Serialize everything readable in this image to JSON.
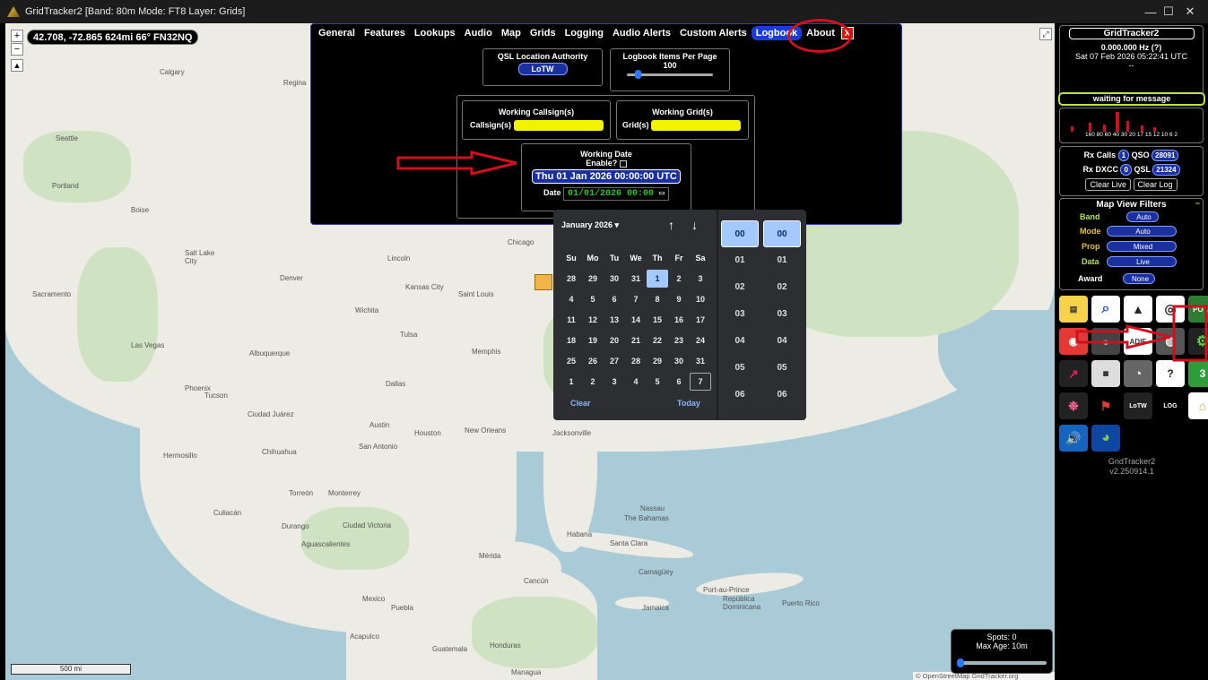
{
  "window": {
    "title": "GridTracker2 [Band: 80m Mode: FT8 Layer: Grids]",
    "minimize": "—",
    "maximize": "☐",
    "close": "✕"
  },
  "map": {
    "coords": "42.708, -72.865 624mi 66° FN32NQ",
    "zoom_in": "+",
    "zoom_out": "−",
    "scale_label": "500 mi",
    "attribution": "© OpenStreetMap GridTracker.org",
    "spots_label": "Spots: 0",
    "max_age_label": "Max Age: 10m",
    "cities": [
      {
        "n": "Calgary"
      },
      {
        "n": "Regina"
      },
      {
        "n": "Seattle"
      },
      {
        "n": "Portland"
      },
      {
        "n": "Boise"
      },
      {
        "n": "Salt Lake City"
      },
      {
        "n": "Denver"
      },
      {
        "n": "Sacramento"
      },
      {
        "n": "Las Vegas"
      },
      {
        "n": "Phoenix"
      },
      {
        "n": "Tucson"
      },
      {
        "n": "Albuquerque"
      },
      {
        "n": "Wichita"
      },
      {
        "n": "Kansas City"
      },
      {
        "n": "Lincoln"
      },
      {
        "n": "Chicago"
      },
      {
        "n": "Saint Louis"
      },
      {
        "n": "Tulsa"
      },
      {
        "n": "Memphis"
      },
      {
        "n": "Dallas"
      },
      {
        "n": "Austin"
      },
      {
        "n": "Houston"
      },
      {
        "n": "San Antonio"
      },
      {
        "n": "New Orleans"
      },
      {
        "n": "Jacksonville"
      },
      {
        "n": "Ciudad Juárez"
      },
      {
        "n": "Chihuahua"
      },
      {
        "n": "Monterrey"
      },
      {
        "n": "Culiacán"
      },
      {
        "n": "Durango"
      },
      {
        "n": "Aguascalientes"
      },
      {
        "n": "Ciudad Victoria"
      },
      {
        "n": "Mexico"
      },
      {
        "n": "Puebla"
      },
      {
        "n": "Acapulco"
      },
      {
        "n": "Mérida"
      },
      {
        "n": "Cancún"
      },
      {
        "n": "Habana"
      },
      {
        "n": "Santa Clara"
      },
      {
        "n": "Camagüey"
      },
      {
        "n": "The Bahamas"
      },
      {
        "n": "Nassau"
      },
      {
        "n": "Jamaica"
      },
      {
        "n": "Port-au-Prince"
      },
      {
        "n": "República Dominicana"
      },
      {
        "n": "Puerto Rico"
      },
      {
        "n": "Guatemala"
      },
      {
        "n": "Honduras"
      },
      {
        "n": "Managua"
      },
      {
        "n": "Torreón"
      },
      {
        "n": "Hermosillo"
      }
    ]
  },
  "settings": {
    "tabs": [
      "General",
      "Features",
      "Lookups",
      "Audio",
      "Map",
      "Grids",
      "Logging",
      "Audio Alerts",
      "Custom Alerts",
      "Logbook",
      "About"
    ],
    "active_tab": "Logbook",
    "close_label": "X",
    "qsl_authority": {
      "label": "QSL Location Authority",
      "value": "LoTW"
    },
    "items_per_page": {
      "label": "Logbook Items Per Page",
      "value": "100",
      "slider_fraction": 0.1
    },
    "working_callsign": {
      "label": "Working Callsign(s)",
      "field_label": "Callsign(s)",
      "value": ""
    },
    "working_grid": {
      "label": "Working Grid(s)",
      "field_label": "Grid(s)",
      "value": ""
    },
    "working_date": {
      "label": "Working Date",
      "enable_label": "Enable?",
      "enabled": false,
      "display": "Thu 01 Jan 2026 00:00:00 UTC",
      "date_label": "Date",
      "date_value": "01/01/2026 00:00"
    }
  },
  "calendar": {
    "month_label": "January 2026 ▾",
    "up": "↑",
    "down": "↓",
    "weekdays": [
      "Su",
      "Mo",
      "Tu",
      "We",
      "Th",
      "Fr",
      "Sa"
    ],
    "weeks": [
      [
        "28",
        "29",
        "30",
        "31",
        "1",
        "2",
        "3"
      ],
      [
        "4",
        "5",
        "6",
        "7",
        "8",
        "9",
        "10"
      ],
      [
        "11",
        "12",
        "13",
        "14",
        "15",
        "16",
        "17"
      ],
      [
        "18",
        "19",
        "20",
        "21",
        "22",
        "23",
        "24"
      ],
      [
        "25",
        "26",
        "27",
        "28",
        "29",
        "30",
        "31"
      ],
      [
        "1",
        "2",
        "3",
        "4",
        "5",
        "6",
        "7"
      ]
    ],
    "selected_day": "1",
    "clear_label": "Clear",
    "today_label": "Today",
    "hours": [
      "00",
      "01",
      "02",
      "03",
      "04",
      "05",
      "06"
    ],
    "minutes": [
      "00",
      "01",
      "02",
      "03",
      "04",
      "05",
      "06"
    ]
  },
  "sidebar": {
    "app_name": "GridTracker2",
    "frequency": "0.000.000 Hz (?)",
    "datetime": "Sat 07 Feb 2026 05:22:41 UTC",
    "dash": "--",
    "status": "waiting for message",
    "bands": "160 80 60 40 30 20 17 15 12 10 6 2",
    "rx_calls_label": "Rx Calls",
    "rx_calls": "1",
    "qso_label": "QSO",
    "qso": "28091",
    "rx_dxcc_label": "Rx DXCC",
    "rx_dxcc": "0",
    "qsl_label": "QSL",
    "qsl": "21324",
    "clear_live": "Clear Live",
    "clear_log": "Clear Log",
    "filters_title": "Map View Filters",
    "filters_collapse": "−",
    "filters": [
      {
        "label": "Band",
        "value": "Auto"
      },
      {
        "label": "Mode",
        "value": "Auto"
      },
      {
        "label": "Prop",
        "value": "Mixed"
      },
      {
        "label": "Data",
        "value": "Live"
      },
      {
        "label": "Award",
        "value": "None"
      }
    ],
    "version_name": "GridTracker2",
    "version": "v2.250914.1"
  }
}
